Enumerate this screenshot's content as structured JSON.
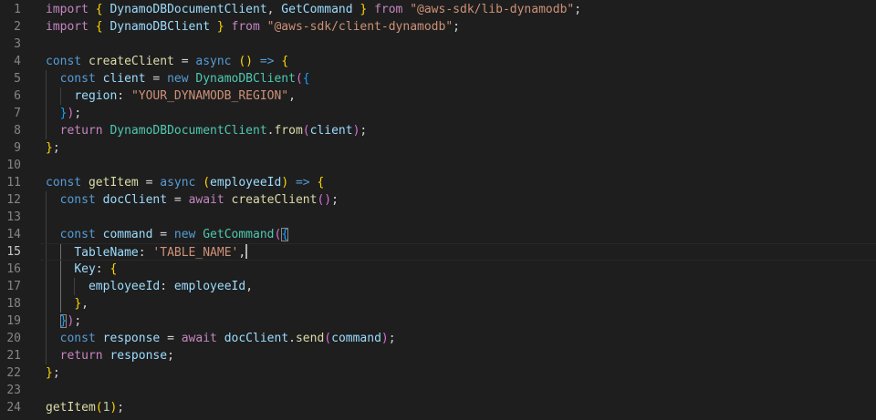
{
  "editor": {
    "current_line": 15,
    "lines": [
      {
        "n": "1",
        "tokens": [
          [
            "ctl",
            "import"
          ],
          [
            "pun",
            " "
          ],
          [
            "b1",
            "{"
          ],
          [
            "pun",
            " "
          ],
          [
            "var",
            "DynamoDBDocumentClient"
          ],
          [
            "pun",
            ", "
          ],
          [
            "var",
            "GetCommand"
          ],
          [
            "pun",
            " "
          ],
          [
            "b1",
            "}"
          ],
          [
            "pun",
            " "
          ],
          [
            "ctl",
            "from"
          ],
          [
            "pun",
            " "
          ],
          [
            "str",
            "\"@aws-sdk/lib-dynamodb\""
          ],
          [
            "pun",
            ";"
          ]
        ]
      },
      {
        "n": "2",
        "tokens": [
          [
            "ctl",
            "import"
          ],
          [
            "pun",
            " "
          ],
          [
            "b1",
            "{"
          ],
          [
            "pun",
            " "
          ],
          [
            "var",
            "DynamoDBClient"
          ],
          [
            "pun",
            " "
          ],
          [
            "b1",
            "}"
          ],
          [
            "pun",
            " "
          ],
          [
            "ctl",
            "from"
          ],
          [
            "pun",
            " "
          ],
          [
            "str",
            "\"@aws-sdk/client-dynamodb\""
          ],
          [
            "pun",
            ";"
          ]
        ]
      },
      {
        "n": "3",
        "tokens": []
      },
      {
        "n": "4",
        "tokens": [
          [
            "kw",
            "const"
          ],
          [
            "pun",
            " "
          ],
          [
            "fn",
            "createClient"
          ],
          [
            "pun",
            " = "
          ],
          [
            "kw",
            "async"
          ],
          [
            "pun",
            " "
          ],
          [
            "b1",
            "()"
          ],
          [
            "pun",
            " "
          ],
          [
            "kw",
            "=>"
          ],
          [
            "pun",
            " "
          ],
          [
            "b1",
            "{"
          ]
        ]
      },
      {
        "n": "5",
        "tokens": [
          [
            "pun",
            "  "
          ],
          [
            "kw",
            "const"
          ],
          [
            "pun",
            " "
          ],
          [
            "var",
            "client"
          ],
          [
            "pun",
            " = "
          ],
          [
            "kw",
            "new"
          ],
          [
            "pun",
            " "
          ],
          [
            "cls",
            "DynamoDBClient"
          ],
          [
            "b2",
            "("
          ],
          [
            "b3",
            "{"
          ]
        ]
      },
      {
        "n": "6",
        "tokens": [
          [
            "pun",
            "    "
          ],
          [
            "var",
            "region"
          ],
          [
            "pun",
            ": "
          ],
          [
            "str",
            "\"YOUR_DYNAMODB_REGION\""
          ],
          [
            "pun",
            ","
          ]
        ]
      },
      {
        "n": "7",
        "tokens": [
          [
            "pun",
            "  "
          ],
          [
            "b3",
            "}"
          ],
          [
            "b2",
            ")"
          ],
          [
            "pun",
            ";"
          ]
        ]
      },
      {
        "n": "8",
        "tokens": [
          [
            "pun",
            "  "
          ],
          [
            "ctl",
            "return"
          ],
          [
            "pun",
            " "
          ],
          [
            "cls",
            "DynamoDBDocumentClient"
          ],
          [
            "pun",
            "."
          ],
          [
            "fn",
            "from"
          ],
          [
            "b2",
            "("
          ],
          [
            "var",
            "client"
          ],
          [
            "b2",
            ")"
          ],
          [
            "pun",
            ";"
          ]
        ]
      },
      {
        "n": "9",
        "tokens": [
          [
            "b1",
            "}"
          ],
          [
            "pun",
            ";"
          ]
        ]
      },
      {
        "n": "10",
        "tokens": []
      },
      {
        "n": "11",
        "tokens": [
          [
            "kw",
            "const"
          ],
          [
            "pun",
            " "
          ],
          [
            "fn",
            "getItem"
          ],
          [
            "pun",
            " = "
          ],
          [
            "kw",
            "async"
          ],
          [
            "pun",
            " "
          ],
          [
            "b1",
            "("
          ],
          [
            "var",
            "employeeId"
          ],
          [
            "b1",
            ")"
          ],
          [
            "pun",
            " "
          ],
          [
            "kw",
            "=>"
          ],
          [
            "pun",
            " "
          ],
          [
            "b1",
            "{"
          ]
        ]
      },
      {
        "n": "12",
        "tokens": [
          [
            "pun",
            "  "
          ],
          [
            "kw",
            "const"
          ],
          [
            "pun",
            " "
          ],
          [
            "var",
            "docClient"
          ],
          [
            "pun",
            " = "
          ],
          [
            "ctl",
            "await"
          ],
          [
            "pun",
            " "
          ],
          [
            "fn",
            "createClient"
          ],
          [
            "b2",
            "()"
          ],
          [
            "pun",
            ";"
          ]
        ]
      },
      {
        "n": "13",
        "tokens": []
      },
      {
        "n": "14",
        "tokens": [
          [
            "pun",
            "  "
          ],
          [
            "kw",
            "const"
          ],
          [
            "pun",
            " "
          ],
          [
            "var",
            "command"
          ],
          [
            "pun",
            " = "
          ],
          [
            "kw",
            "new"
          ],
          [
            "pun",
            " "
          ],
          [
            "cls",
            "GetCommand"
          ],
          [
            "b2",
            "("
          ],
          [
            "b3 bm",
            "{"
          ]
        ]
      },
      {
        "n": "15",
        "tokens": [
          [
            "pun",
            "    "
          ],
          [
            "var",
            "TableName"
          ],
          [
            "pun",
            ": "
          ],
          [
            "str",
            "'TABLE_NAME'"
          ],
          [
            "pun",
            ","
          ],
          [
            "cursor",
            ""
          ]
        ]
      },
      {
        "n": "16",
        "tokens": [
          [
            "pun",
            "    "
          ],
          [
            "var",
            "Key"
          ],
          [
            "pun",
            ": "
          ],
          [
            "b1",
            "{"
          ]
        ]
      },
      {
        "n": "17",
        "tokens": [
          [
            "pun",
            "      "
          ],
          [
            "var",
            "employeeId"
          ],
          [
            "pun",
            ": "
          ],
          [
            "var",
            "employeeId"
          ],
          [
            "pun",
            ","
          ]
        ]
      },
      {
        "n": "18",
        "tokens": [
          [
            "pun",
            "    "
          ],
          [
            "b1",
            "}"
          ],
          [
            "pun",
            ","
          ]
        ]
      },
      {
        "n": "19",
        "tokens": [
          [
            "pun",
            "  "
          ],
          [
            "b3 bm",
            "}"
          ],
          [
            "b2",
            ")"
          ],
          [
            "pun",
            ";"
          ]
        ]
      },
      {
        "n": "20",
        "tokens": [
          [
            "pun",
            "  "
          ],
          [
            "kw",
            "const"
          ],
          [
            "pun",
            " "
          ],
          [
            "var",
            "response"
          ],
          [
            "pun",
            " = "
          ],
          [
            "ctl",
            "await"
          ],
          [
            "pun",
            " "
          ],
          [
            "var",
            "docClient"
          ],
          [
            "pun",
            "."
          ],
          [
            "fn",
            "send"
          ],
          [
            "b2",
            "("
          ],
          [
            "var",
            "command"
          ],
          [
            "b2",
            ")"
          ],
          [
            "pun",
            ";"
          ]
        ]
      },
      {
        "n": "21",
        "tokens": [
          [
            "pun",
            "  "
          ],
          [
            "ctl",
            "return"
          ],
          [
            "pun",
            " "
          ],
          [
            "var",
            "response"
          ],
          [
            "pun",
            ";"
          ]
        ]
      },
      {
        "n": "22",
        "tokens": [
          [
            "b1",
            "}"
          ],
          [
            "pun",
            ";"
          ]
        ]
      },
      {
        "n": "23",
        "tokens": []
      },
      {
        "n": "24",
        "tokens": [
          [
            "fn",
            "getItem"
          ],
          [
            "b1",
            "("
          ],
          [
            "num",
            "1"
          ],
          [
            "b1",
            ")"
          ],
          [
            "pun",
            ";"
          ]
        ]
      }
    ]
  }
}
